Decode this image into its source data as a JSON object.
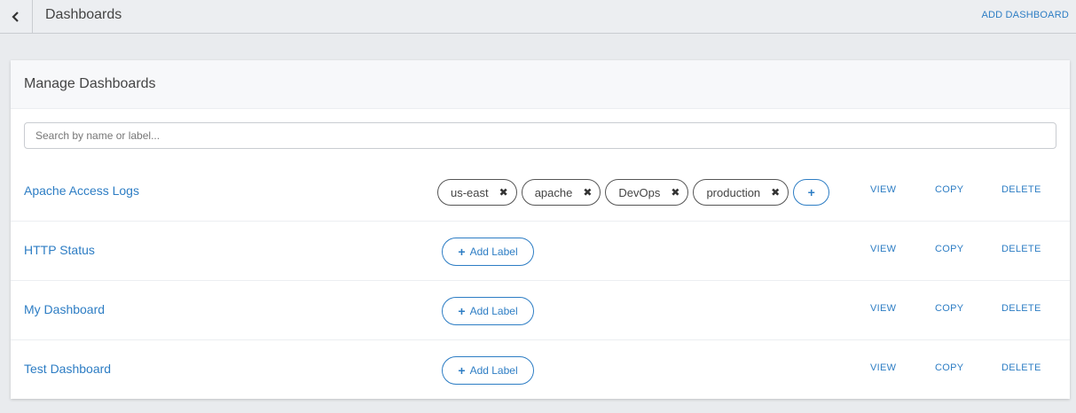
{
  "topbar": {
    "title": "Dashboards",
    "add_label": "ADD DASHBOARD"
  },
  "panel": {
    "title": "Manage Dashboards",
    "search_placeholder": "Search by name or label..."
  },
  "actions": {
    "view": "VIEW",
    "copy": "COPY",
    "delete": "DELETE"
  },
  "add_label_text": "Add Label",
  "dashboards": [
    {
      "name": "Apache Access Logs",
      "labels": [
        "us-east",
        "apache",
        "DevOps",
        "production"
      ]
    },
    {
      "name": "HTTP Status",
      "labels": []
    },
    {
      "name": "My Dashboard",
      "labels": []
    },
    {
      "name": "Test Dashboard",
      "labels": []
    }
  ],
  "icons": {
    "back": "chevron-left-icon",
    "remove": "close-icon",
    "add": "plus-icon"
  },
  "colors": {
    "accent": "#2d7dc4",
    "background": "#e9ebee",
    "panel": "#ffffff"
  }
}
